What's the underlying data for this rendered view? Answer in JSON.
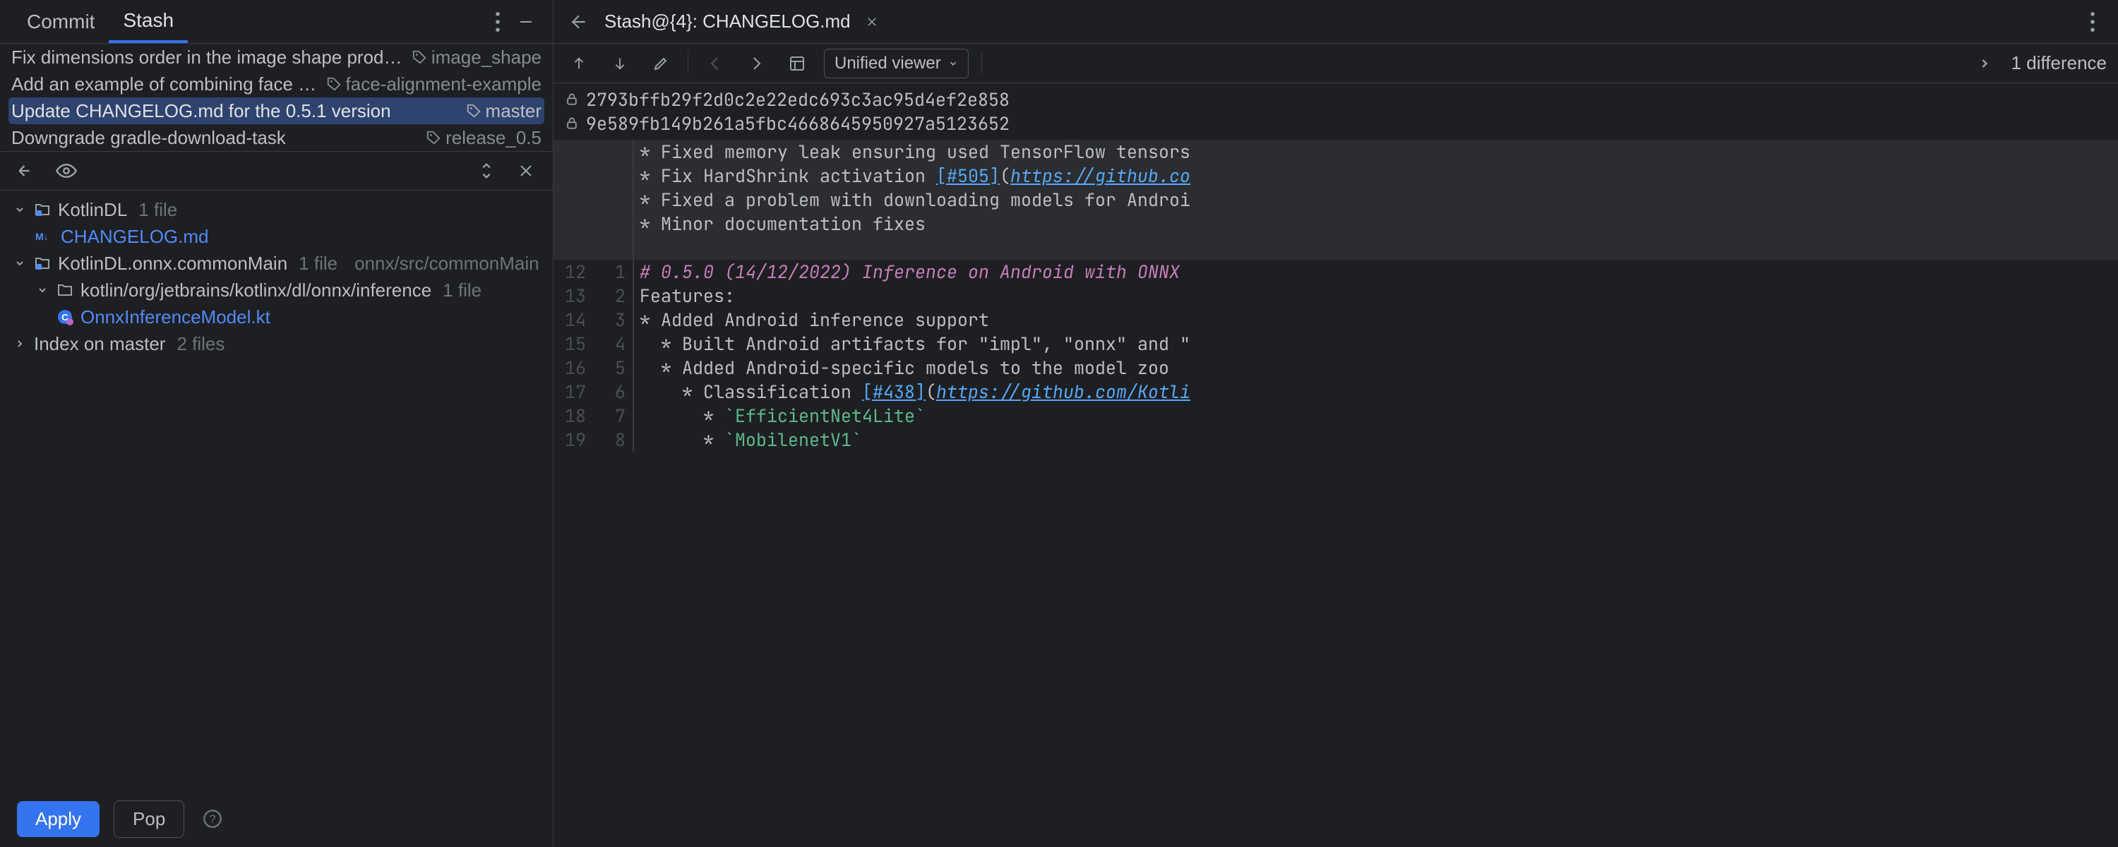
{
  "tabs": {
    "commit": "Commit",
    "stash": "Stash"
  },
  "commits": [
    {
      "msg": "Fix dimensions order in the image shape produced by prepro",
      "branch": "image_shape"
    },
    {
      "msg": "Add an example of combining face detection and ",
      "branch": "face-alignment-example"
    },
    {
      "msg": "Update CHANGELOG.md for the 0.5.1 version",
      "branch": "master"
    },
    {
      "msg": "Downgrade gradle-download-task",
      "branch": "release_0.5"
    }
  ],
  "tree": {
    "root1": {
      "name": "KotlinDL",
      "meta": "1 file"
    },
    "file1": "CHANGELOG.md",
    "root2": {
      "name": "KotlinDL.onnx.commonMain",
      "meta": "1 file",
      "path": "onnx/src/commonMain"
    },
    "dir2": {
      "name": "kotlin/org/jetbrains/kotlinx/dl/onnx/inference",
      "meta": "1 file"
    },
    "file2": "OnnxInferenceModel.kt",
    "root3": {
      "name": "Index on master",
      "meta": "2 files"
    }
  },
  "buttons": {
    "apply": "Apply",
    "pop": "Pop"
  },
  "right": {
    "title": "Stash@{4}: CHANGELOG.md",
    "viewer": "Unified viewer",
    "diffcount": "1 difference",
    "hash1": "2793bffb29f2d0c2e22edc693c3ac95d4ef2e858",
    "hash2": "9e589fb149b261a5fbc4668645950927a5123652"
  },
  "code": {
    "ctx": [
      "* Fixed memory leak ensuring used TensorFlow tensors",
      "* Fix HardShrink activation ",
      "* Fixed a problem with downloading models for Androi",
      "* Minor documentation fixes",
      ""
    ],
    "link505": "[#505]",
    "url505": "https://github.co",
    "lines": [
      {
        "l": "12",
        "r": "1",
        "type": "heading",
        "text": "# 0.5.0 (14/12/2022) Inference on Android with ONNX"
      },
      {
        "l": "13",
        "r": "2",
        "type": "plain",
        "text": "Features:"
      },
      {
        "l": "14",
        "r": "3",
        "type": "bullet",
        "text": "* Added Android inference support"
      },
      {
        "l": "15",
        "r": "4",
        "type": "bullet2",
        "text": "  * Built Android artifacts for \"impl\", \"onnx\" and \""
      },
      {
        "l": "16",
        "r": "5",
        "type": "bullet2",
        "text": "  * Added Android-specific models to the model zoo"
      },
      {
        "l": "17",
        "r": "6",
        "type": "classif",
        "pre": "    * Classification ",
        "link": "[#438]",
        "url": "https://github.com/Kotli"
      },
      {
        "l": "18",
        "r": "7",
        "type": "code",
        "pre": "      * ",
        "code": "`EfficientNet4Lite`"
      },
      {
        "l": "19",
        "r": "8",
        "type": "code",
        "pre": "      * ",
        "code": "`MobilenetV1`"
      }
    ]
  }
}
